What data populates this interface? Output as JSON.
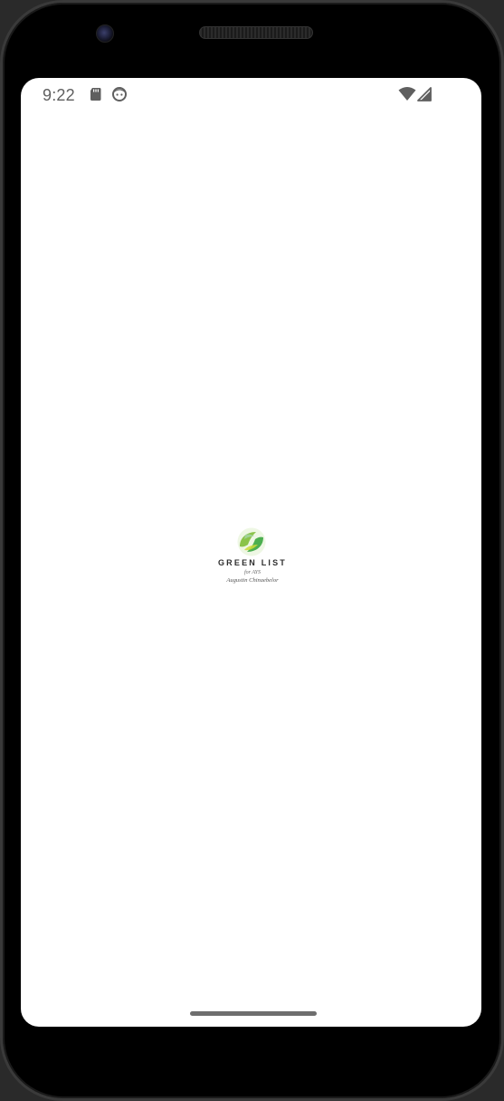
{
  "status_bar": {
    "time": "9:22",
    "icons": [
      "sd-card-icon",
      "face-icon",
      "wifi-icon",
      "cell-signal-icon"
    ]
  },
  "splash": {
    "app_name": "GREEN LIST",
    "for_line": "for AYS",
    "author": "Augustin Chinaebelor",
    "logo_colors": [
      "#8BC34A",
      "#4CAF50",
      "#CDDC39"
    ]
  },
  "colors": {
    "screen_background": "#ffffff",
    "device_frame": "#000000",
    "status_text": "#5f5f5f"
  }
}
